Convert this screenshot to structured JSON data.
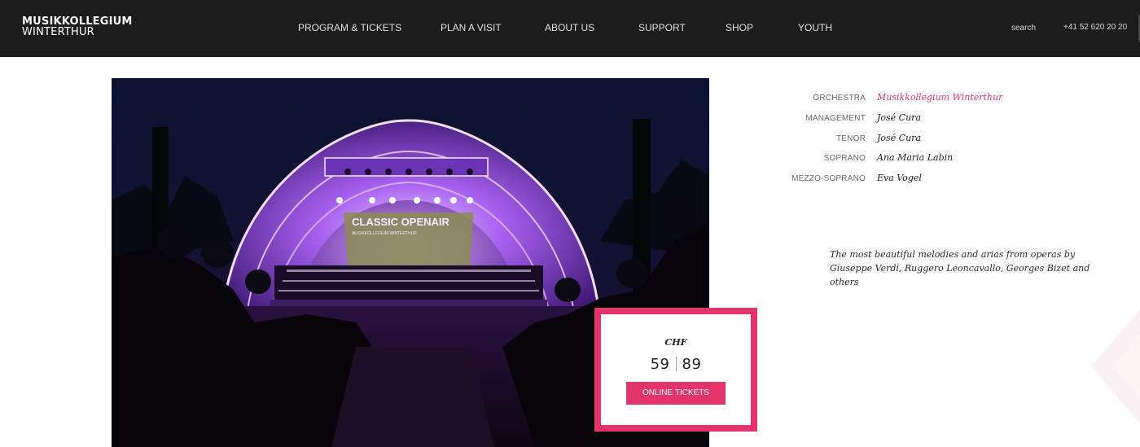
{
  "header": {
    "logo_line1": "MUSIKKOLLEGIUM",
    "logo_line2": "WINTERTHUR",
    "nav": [
      {
        "label": "PROGRAM & TICKETS"
      },
      {
        "label": "PLAN A VISIT"
      },
      {
        "label": "ABOUT US"
      },
      {
        "label": "SUPPORT"
      },
      {
        "label": "SHOP"
      },
      {
        "label": "YOUTH"
      }
    ],
    "search_label": "search",
    "phone": "+41 52 620 20 20"
  },
  "hero": {
    "stage_text": "CLASSIC OPENAIR",
    "stage_subtext": "MUSIKKOLLEGIUM WINTERTHUR"
  },
  "ticket": {
    "currency": "CHF",
    "price_low": "59",
    "price_high": "89",
    "button_label": "ONLINE TICKETS",
    "accent_color": "#e5336b"
  },
  "credits": [
    {
      "role": "ORCHESTRA",
      "name": "Musikkollegium Winterthur",
      "is_link": true
    },
    {
      "role": "MANAGEMENT",
      "name": "José Cura",
      "is_link": false
    },
    {
      "role": "TENOR",
      "name": "José Cura",
      "is_link": false
    },
    {
      "role": "SOPRANO",
      "name": "Ana Maria Labin",
      "is_link": false
    },
    {
      "role": "MEZZO-SOPRANO",
      "name": "Eva Vogel",
      "is_link": false
    }
  ],
  "description": "The most beautiful melodies and arias from operas by Giuseppe Verdi, Ruggero Leoncavallo, Georges Bizet and others"
}
